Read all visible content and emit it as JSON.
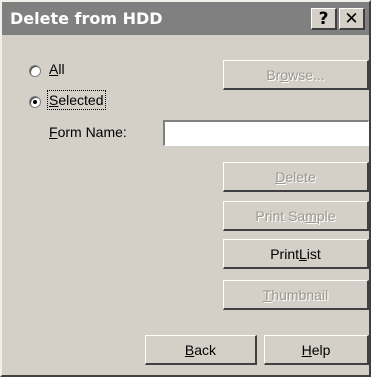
{
  "window": {
    "title": "Delete from HDD"
  },
  "titlebar": {
    "help_glyph": "?",
    "close_glyph": "✕"
  },
  "options": {
    "all": {
      "pre": "",
      "mnemonic": "A",
      "post": "ll",
      "selected": false
    },
    "selected": {
      "pre": "",
      "mnemonic": "S",
      "post": "elected",
      "selected": true
    }
  },
  "form_name": {
    "pre": "",
    "mnemonic": "F",
    "post": "orm Name:",
    "value": ""
  },
  "buttons": {
    "browse": {
      "pre": "Br",
      "mnemonic": "o",
      "post": "wse...",
      "enabled": false
    },
    "delete": {
      "pre": "",
      "mnemonic": "D",
      "post": "elete",
      "enabled": false
    },
    "print_sample": {
      "pre": "Print Sa",
      "mnemonic": "m",
      "post": "ple",
      "enabled": false
    },
    "print_list": {
      "pre": "Print ",
      "mnemonic": "L",
      "post": "ist",
      "enabled": true
    },
    "thumbnail": {
      "pre": "",
      "mnemonic": "T",
      "post": "humbnail",
      "enabled": false
    },
    "back": {
      "pre": "",
      "mnemonic": "B",
      "post": "ack",
      "enabled": true
    },
    "help": {
      "pre": "",
      "mnemonic": "H",
      "post": "elp",
      "enabled": true
    }
  },
  "colors": {
    "face": "#d4d0c8",
    "titlebar": "#808080",
    "disabled_text": "#9a9890"
  }
}
